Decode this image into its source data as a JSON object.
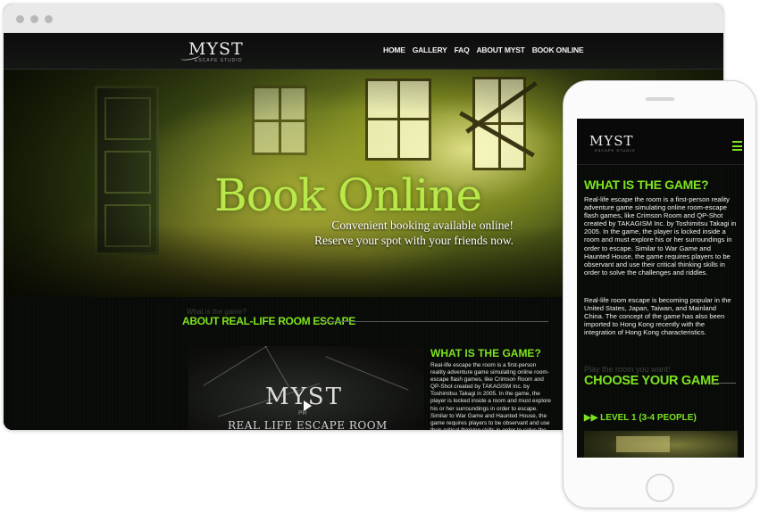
{
  "desktop": {
    "window_controls": [
      "close",
      "minimize",
      "maximize"
    ],
    "logo": {
      "text": "MYST",
      "subtext": "ESCAPE STUDIO"
    },
    "nav": [
      "HOME",
      "GALLERY",
      "FAQ",
      "ABOUT MYST",
      "BOOK ONLINE"
    ],
    "hero": {
      "title": "Book Online",
      "subtitle_line1": "Convenient booking available online!",
      "subtitle_line2": "Reserve your spot with your friends now."
    },
    "about": {
      "ghost_text": "What is the game?",
      "heading": "ABOUT REAL-LIFE ROOM ESCAPE",
      "video": {
        "logo": "MYST",
        "pr": "PR",
        "subtitle": "REAL LIFE ESCAPE ROOM"
      },
      "game_title": "WHAT IS THE GAME?",
      "game_text": "Real-life escape the room is a first-person reality adventure game simulating online room-escape flash games, like Crimson Room and QP-Shot created by TAKAGISM Inc. by Toshimitsu Takagi in 2005. In the game, the player is locked inside a room and must explore his or her surroundings in order to escape. Similar to War Game and Haunted House, the game requires players to be observant and use their critical thinking skills in order to solve the challenges and riddles."
    }
  },
  "mobile": {
    "logo": {
      "text": "MYST",
      "subtext": "ESCAPE STUDIO"
    },
    "title": "WHAT IS THE GAME?",
    "paragraph1": "Real-life escape the room is a first-person reality adventure game simulating online room-escape flash games, like Crimson Room and QP-Shot created by TAKAGISM Inc. by Toshimitsu Takagi in 2005. In the game, the player is locked inside a room and must explore his or her surroundings in order to escape. Similar to War Game and Haunted House, the game requires players to be observant and use their critical thinking skills in order to solve the challenges and riddles.",
    "paragraph2": "Real-life room escape is becoming popular in the United States, Japan, Taiwan, and Mainland China. The concept of the game has also been imported to Hong Kong recently with the integration of Hong Kong characteristics.",
    "ghost_text": "Play the room you want!",
    "choose_heading": "CHOOSE YOUR GAME",
    "level_arrow": "▶▶",
    "level_label": "LEVEL 1 (3-4 PEOPLE)"
  },
  "colors": {
    "accent": "#7ee320",
    "hero_title": "#b9e84b",
    "background": "#050605"
  },
  "icons": {
    "menu": "hamburger-icon",
    "play": "play-icon"
  }
}
